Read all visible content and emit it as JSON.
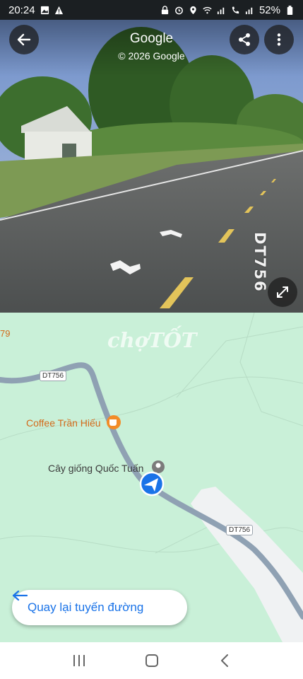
{
  "status_bar": {
    "time": "20:24",
    "battery": "52%"
  },
  "street_view": {
    "title": "Google",
    "subtitle": "© 2026 Google",
    "road_sign": "DT756"
  },
  "map": {
    "edge_number": "79",
    "watermark": "chợTỐT",
    "road_shield_1": "DT756",
    "road_shield_2": "DT756",
    "poi_coffee": "Coffee Trần Hiếu",
    "poi_nursery": "Cây giống Quốc Tuấn",
    "back_to_route_label": "Quay lại tuyến đường"
  },
  "icons": [
    "back-arrow-icon",
    "share-icon",
    "more-vert-icon",
    "expand-icon",
    "coffee-icon",
    "pin-icon",
    "navigation-arrow-icon",
    "recents-icon",
    "home-icon",
    "nav-back-icon"
  ],
  "colors": {
    "map_green": "#c9f0d8",
    "road": "#8fa1b3",
    "accent_blue": "#1a73e8",
    "poi_orange": "#d36a1a"
  }
}
